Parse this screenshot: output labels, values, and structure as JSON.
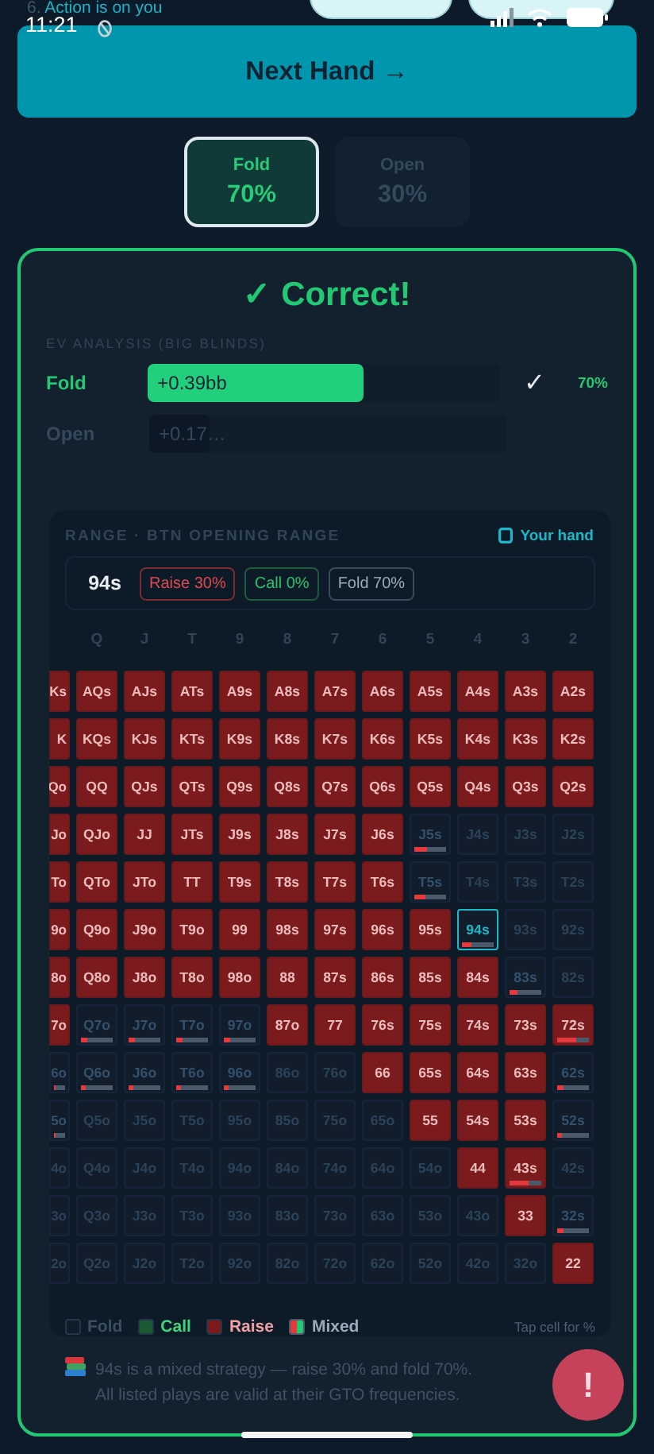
{
  "notification": {
    "number": "6.",
    "text": "Action is on you"
  },
  "status_bar": {
    "time": "11:21"
  },
  "next_button": {
    "label": "Next Hand →"
  },
  "options": [
    {
      "label": "Fold",
      "share": "70%",
      "selected": true
    },
    {
      "label": "Open",
      "share": "30%",
      "selected": false
    }
  ],
  "result": {
    "verdict": "✓ Correct!",
    "ev_title": "EV ANALYSIS (BIG BLINDS)",
    "ev_rows": [
      {
        "action": "Fold",
        "value": "+0.39bb",
        "level": 0.61,
        "chosen": true,
        "mark": "✓",
        "frequency": "70%"
      },
      {
        "action": "Open",
        "value": "+0.17…",
        "level": 0.17,
        "chosen": false
      }
    ],
    "note": "94s is a mixed strategy — raise 30% and fold 70%. All listed plays are valid at their GTO frequencies."
  },
  "range": {
    "title": "RANGE · BTN OPENING RANGE",
    "your_hand_label": "Your hand",
    "hand": "94s",
    "stats": [
      {
        "kind": "raise",
        "label": "Raise",
        "value": "30%"
      },
      {
        "kind": "call",
        "label": "Call",
        "value": "0%"
      },
      {
        "kind": "fold",
        "label": "Fold",
        "value": "70%"
      }
    ],
    "columns": [
      "",
      "Q",
      "J",
      "T",
      "9",
      "8",
      "7",
      "6",
      "5",
      "4",
      "3",
      "2"
    ],
    "rows": [
      [
        {
          "label": "Ks",
          "kind": "raise",
          "selected": false
        },
        {
          "label": "AQs",
          "kind": "raise",
          "selected": false
        },
        {
          "label": "AJs",
          "kind": "raise",
          "selected": false
        },
        {
          "label": "ATs",
          "kind": "raise",
          "selected": false
        },
        {
          "label": "A9s",
          "kind": "raise",
          "selected": false
        },
        {
          "label": "A8s",
          "kind": "raise",
          "selected": false
        },
        {
          "label": "A7s",
          "kind": "raise",
          "selected": false
        },
        {
          "label": "A6s",
          "kind": "raise",
          "selected": false
        },
        {
          "label": "A5s",
          "kind": "raise",
          "selected": false
        },
        {
          "label": "A4s",
          "kind": "raise",
          "selected": false
        },
        {
          "label": "A3s",
          "kind": "raise",
          "selected": false
        },
        {
          "label": "A2s",
          "kind": "raise",
          "selected": false
        }
      ],
      [
        {
          "label": "K",
          "kind": "raise",
          "selected": false
        },
        {
          "label": "KQs",
          "kind": "raise",
          "selected": false
        },
        {
          "label": "KJs",
          "kind": "raise",
          "selected": false
        },
        {
          "label": "KTs",
          "kind": "raise",
          "selected": false
        },
        {
          "label": "K9s",
          "kind": "raise",
          "selected": false
        },
        {
          "label": "K8s",
          "kind": "raise",
          "selected": false
        },
        {
          "label": "K7s",
          "kind": "raise",
          "selected": false
        },
        {
          "label": "K6s",
          "kind": "raise",
          "selected": false
        },
        {
          "label": "K5s",
          "kind": "raise",
          "selected": false
        },
        {
          "label": "K4s",
          "kind": "raise",
          "selected": false
        },
        {
          "label": "K3s",
          "kind": "raise",
          "selected": false
        },
        {
          "label": "K2s",
          "kind": "raise",
          "selected": false
        }
      ],
      [
        {
          "label": "Qo",
          "kind": "raise",
          "selected": false
        },
        {
          "label": "QQ",
          "kind": "raise",
          "selected": false
        },
        {
          "label": "QJs",
          "kind": "raise",
          "selected": false
        },
        {
          "label": "QTs",
          "kind": "raise",
          "selected": false
        },
        {
          "label": "Q9s",
          "kind": "raise",
          "selected": false
        },
        {
          "label": "Q8s",
          "kind": "raise",
          "selected": false
        },
        {
          "label": "Q7s",
          "kind": "raise",
          "selected": false
        },
        {
          "label": "Q6s",
          "kind": "raise",
          "selected": false
        },
        {
          "label": "Q5s",
          "kind": "raise",
          "selected": false
        },
        {
          "label": "Q4s",
          "kind": "raise",
          "selected": false
        },
        {
          "label": "Q3s",
          "kind": "raise",
          "selected": false
        },
        {
          "label": "Q2s",
          "kind": "raise",
          "selected": false
        }
      ],
      [
        {
          "label": "Jo",
          "kind": "raise",
          "selected": false
        },
        {
          "label": "QJo",
          "kind": "raise",
          "selected": false
        },
        {
          "label": "JJ",
          "kind": "raise",
          "selected": false
        },
        {
          "label": "JTs",
          "kind": "raise",
          "selected": false
        },
        {
          "label": "J9s",
          "kind": "raise",
          "selected": false
        },
        {
          "label": "J8s",
          "kind": "raise",
          "selected": false
        },
        {
          "label": "J7s",
          "kind": "raise",
          "selected": false
        },
        {
          "label": "J6s",
          "kind": "raise",
          "selected": false
        },
        {
          "label": "J5s",
          "kind": "mixed",
          "level": 0.4,
          "selected": false
        },
        {
          "label": "J4s",
          "kind": "fold",
          "selected": false
        },
        {
          "label": "J3s",
          "kind": "fold",
          "selected": false
        },
        {
          "label": "J2s",
          "kind": "fold",
          "selected": false
        }
      ],
      [
        {
          "label": "To",
          "kind": "raise",
          "selected": false
        },
        {
          "label": "QTo",
          "kind": "raise",
          "selected": false
        },
        {
          "label": "JTo",
          "kind": "raise",
          "selected": false
        },
        {
          "label": "TT",
          "kind": "raise",
          "selected": false
        },
        {
          "label": "T9s",
          "kind": "raise",
          "selected": false
        },
        {
          "label": "T8s",
          "kind": "raise",
          "selected": false
        },
        {
          "label": "T7s",
          "kind": "raise",
          "selected": false
        },
        {
          "label": "T6s",
          "kind": "raise",
          "selected": false
        },
        {
          "label": "T5s",
          "kind": "mixed",
          "level": 0.35,
          "selected": false
        },
        {
          "label": "T4s",
          "kind": "fold",
          "selected": false
        },
        {
          "label": "T3s",
          "kind": "fold",
          "selected": false
        },
        {
          "label": "T2s",
          "kind": "fold",
          "selected": false
        }
      ],
      [
        {
          "label": "9o",
          "kind": "raise",
          "selected": false
        },
        {
          "label": "Q9o",
          "kind": "raise",
          "selected": false
        },
        {
          "label": "J9o",
          "kind": "raise",
          "selected": false
        },
        {
          "label": "T9o",
          "kind": "raise",
          "selected": false
        },
        {
          "label": "99",
          "kind": "raise",
          "selected": false
        },
        {
          "label": "98s",
          "kind": "raise",
          "selected": false
        },
        {
          "label": "97s",
          "kind": "raise",
          "selected": false
        },
        {
          "label": "96s",
          "kind": "raise",
          "selected": false
        },
        {
          "label": "95s",
          "kind": "raise",
          "selected": false
        },
        {
          "label": "94s",
          "kind": "mixed",
          "level": 0.3,
          "selected": true
        },
        {
          "label": "93s",
          "kind": "fold",
          "selected": false
        },
        {
          "label": "92s",
          "kind": "fold",
          "selected": false
        }
      ],
      [
        {
          "label": "8o",
          "kind": "raise",
          "selected": false
        },
        {
          "label": "Q8o",
          "kind": "raise",
          "selected": false
        },
        {
          "label": "J8o",
          "kind": "raise",
          "selected": false
        },
        {
          "label": "T8o",
          "kind": "raise",
          "selected": false
        },
        {
          "label": "98o",
          "kind": "raise",
          "selected": false
        },
        {
          "label": "88",
          "kind": "raise",
          "selected": false
        },
        {
          "label": "87s",
          "kind": "raise",
          "selected": false
        },
        {
          "label": "86s",
          "kind": "raise",
          "selected": false
        },
        {
          "label": "85s",
          "kind": "raise",
          "selected": false
        },
        {
          "label": "84s",
          "kind": "raise",
          "selected": false
        },
        {
          "label": "83s",
          "kind": "mixed",
          "level": 0.25,
          "selected": false
        },
        {
          "label": "82s",
          "kind": "fold",
          "selected": false
        }
      ],
      [
        {
          "label": "7o",
          "kind": "raise",
          "selected": false
        },
        {
          "label": "Q7o",
          "kind": "mixed",
          "level": 0.2,
          "selected": false
        },
        {
          "label": "J7o",
          "kind": "mixed",
          "level": 0.2,
          "selected": false
        },
        {
          "label": "T7o",
          "kind": "mixed",
          "level": 0.2,
          "selected": false
        },
        {
          "label": "97o",
          "kind": "mixed",
          "level": 0.2,
          "selected": false
        },
        {
          "label": "87o",
          "kind": "raise",
          "selected": false
        },
        {
          "label": "77",
          "kind": "raise",
          "selected": false
        },
        {
          "label": "76s",
          "kind": "raise",
          "selected": false
        },
        {
          "label": "75s",
          "kind": "raise",
          "selected": false
        },
        {
          "label": "74s",
          "kind": "raise",
          "selected": false
        },
        {
          "label": "73s",
          "kind": "raise",
          "selected": false
        },
        {
          "label": "72s",
          "kind": "mixed",
          "level": 0.6,
          "selected": false
        }
      ],
      [
        {
          "label": "6o",
          "kind": "mixed",
          "level": 0.1,
          "selected": false
        },
        {
          "label": "Q6o",
          "kind": "mixed",
          "level": 0.15,
          "selected": false
        },
        {
          "label": "J6o",
          "kind": "mixed",
          "level": 0.15,
          "selected": false
        },
        {
          "label": "T6o",
          "kind": "mixed",
          "level": 0.15,
          "selected": false
        },
        {
          "label": "96o",
          "kind": "mixed",
          "level": 0.15,
          "selected": false
        },
        {
          "label": "86o",
          "kind": "fold",
          "selected": false
        },
        {
          "label": "76o",
          "kind": "fold",
          "selected": false
        },
        {
          "label": "66",
          "kind": "raise",
          "selected": false
        },
        {
          "label": "65s",
          "kind": "raise",
          "selected": false
        },
        {
          "label": "64s",
          "kind": "raise",
          "selected": false
        },
        {
          "label": "63s",
          "kind": "raise",
          "selected": false
        },
        {
          "label": "62s",
          "kind": "mixed",
          "level": 0.18,
          "selected": false
        }
      ],
      [
        {
          "label": "5o",
          "kind": "mixed",
          "level": 0.1,
          "selected": false
        },
        {
          "label": "Q5o",
          "kind": "fold",
          "selected": false
        },
        {
          "label": "J5o",
          "kind": "fold",
          "selected": false
        },
        {
          "label": "T5o",
          "kind": "fold",
          "selected": false
        },
        {
          "label": "95o",
          "kind": "fold",
          "selected": false
        },
        {
          "label": "85o",
          "kind": "fold",
          "selected": false
        },
        {
          "label": "75o",
          "kind": "fold",
          "selected": false
        },
        {
          "label": "65o",
          "kind": "fold",
          "selected": false
        },
        {
          "label": "55",
          "kind": "raise",
          "selected": false
        },
        {
          "label": "54s",
          "kind": "raise",
          "selected": false
        },
        {
          "label": "53s",
          "kind": "raise",
          "selected": false
        },
        {
          "label": "52s",
          "kind": "mixed",
          "level": 0.15,
          "selected": false
        }
      ],
      [
        {
          "label": "4o",
          "kind": "fold",
          "selected": false
        },
        {
          "label": "Q4o",
          "kind": "fold",
          "selected": false
        },
        {
          "label": "J4o",
          "kind": "fold",
          "selected": false
        },
        {
          "label": "T4o",
          "kind": "fold",
          "selected": false
        },
        {
          "label": "94o",
          "kind": "fold",
          "selected": false
        },
        {
          "label": "84o",
          "kind": "fold",
          "selected": false
        },
        {
          "label": "74o",
          "kind": "fold",
          "selected": false
        },
        {
          "label": "64o",
          "kind": "fold",
          "selected": false
        },
        {
          "label": "54o",
          "kind": "fold",
          "selected": false
        },
        {
          "label": "44",
          "kind": "raise",
          "selected": false
        },
        {
          "label": "43s",
          "kind": "mixed",
          "level": 0.6,
          "selected": false
        },
        {
          "label": "42s",
          "kind": "fold",
          "selected": false
        }
      ],
      [
        {
          "label": "3o",
          "kind": "fold",
          "selected": false
        },
        {
          "label": "Q3o",
          "kind": "fold",
          "selected": false
        },
        {
          "label": "J3o",
          "kind": "fold",
          "selected": false
        },
        {
          "label": "T3o",
          "kind": "fold",
          "selected": false
        },
        {
          "label": "93o",
          "kind": "fold",
          "selected": false
        },
        {
          "label": "83o",
          "kind": "fold",
          "selected": false
        },
        {
          "label": "73o",
          "kind": "fold",
          "selected": false
        },
        {
          "label": "63o",
          "kind": "fold",
          "selected": false
        },
        {
          "label": "53o",
          "kind": "fold",
          "selected": false
        },
        {
          "label": "43o",
          "kind": "fold",
          "selected": false
        },
        {
          "label": "33",
          "kind": "raise",
          "selected": false
        },
        {
          "label": "32s",
          "kind": "mixed",
          "level": 0.18,
          "selected": false
        }
      ],
      [
        {
          "label": "2o",
          "kind": "fold",
          "selected": false
        },
        {
          "label": "Q2o",
          "kind": "fold",
          "selected": false
        },
        {
          "label": "J2o",
          "kind": "fold",
          "selected": false
        },
        {
          "label": "T2o",
          "kind": "fold",
          "selected": false
        },
        {
          "label": "92o",
          "kind": "fold",
          "selected": false
        },
        {
          "label": "82o",
          "kind": "fold",
          "selected": false
        },
        {
          "label": "72o",
          "kind": "fold",
          "selected": false
        },
        {
          "label": "62o",
          "kind": "fold",
          "selected": false
        },
        {
          "label": "52o",
          "kind": "fold",
          "selected": false
        },
        {
          "label": "42o",
          "kind": "fold",
          "selected": false
        },
        {
          "label": "32o",
          "kind": "fold",
          "selected": false
        },
        {
          "label": "22",
          "kind": "raise",
          "selected": false
        }
      ]
    ],
    "legend": [
      {
        "kind": "fold",
        "label": "Fold"
      },
      {
        "kind": "call",
        "label": "Call"
      },
      {
        "kind": "raise",
        "label": "Raise"
      },
      {
        "kind": "mixed",
        "label": "Mixed"
      }
    ],
    "hint": "Tap cell for %"
  },
  "alert_button": {
    "label": "!"
  }
}
